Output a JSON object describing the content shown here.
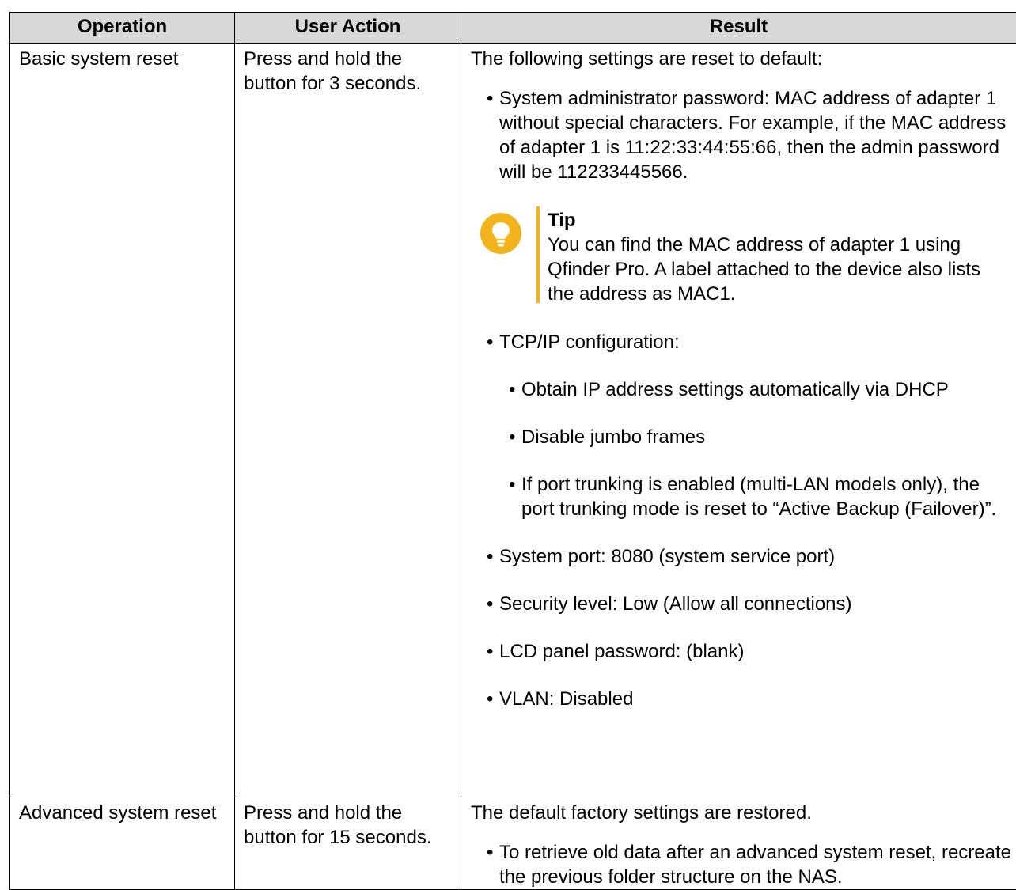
{
  "table": {
    "headers": [
      "Operation",
      "User Action",
      "Result"
    ],
    "rows": [
      {
        "operation": "Basic system reset",
        "user_action": "Press and hold the button for 3 seconds.",
        "result_intro": "The following settings are reset to default:",
        "items": [
          "System administrator password: MAC address of adapter 1 without special characters. For example, if the MAC address of adapter 1 is 11:22:33:44:55:66, then the admin password will be 112233445566.",
          "TCP/IP configuration:",
          "System port: 8080 (system service port)",
          "Security level: Low (Allow all connections)",
          "LCD panel password: (blank)",
          "VLAN: Disabled"
        ],
        "tip": {
          "title": "Tip",
          "text": "You can find the MAC address of adapter 1 using Qfinder Pro. A label attached to the device also lists the address as MAC1.",
          "icon": "lightbulb-icon",
          "accent_color": "#f3b31d"
        },
        "tcpip_items": [
          "Obtain IP address settings automatically via DHCP",
          "Disable jumbo frames",
          "If port trunking is enabled (multi-LAN models only), the port trunking mode is reset to “Active Backup (Failover)”."
        ]
      },
      {
        "operation": "Advanced system reset",
        "user_action": "Press and hold the button for 15 seconds.",
        "result_intro": "The default factory settings are restored.",
        "items": [
          "To retrieve old data after an advanced system reset, recreate the previous folder structure on the NAS."
        ]
      }
    ]
  },
  "colors": {
    "header_bg": "#d8d8d8",
    "border": "#000000",
    "tip_accent": "#f3b31d"
  }
}
